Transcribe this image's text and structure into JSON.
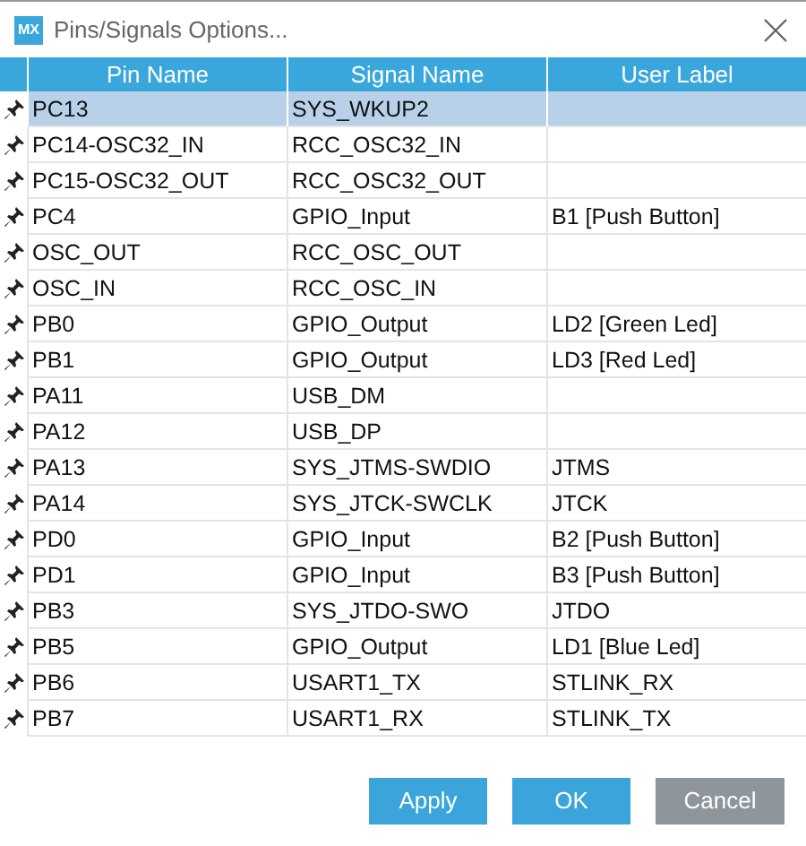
{
  "window": {
    "title": "Pins/Signals Options..."
  },
  "table": {
    "columns": [
      "Pin Name",
      "Signal Name",
      "User Label"
    ],
    "rows": [
      {
        "pin": "PC13",
        "signal": "SYS_WKUP2",
        "label": "",
        "selected": true
      },
      {
        "pin": "PC14-OSC32_IN",
        "signal": "RCC_OSC32_IN",
        "label": "",
        "selected": false
      },
      {
        "pin": "PC15-OSC32_OUT",
        "signal": "RCC_OSC32_OUT",
        "label": "",
        "selected": false
      },
      {
        "pin": "PC4",
        "signal": "GPIO_Input",
        "label": "B1 [Push Button]",
        "selected": false
      },
      {
        "pin": "OSC_OUT",
        "signal": "RCC_OSC_OUT",
        "label": "",
        "selected": false
      },
      {
        "pin": "OSC_IN",
        "signal": "RCC_OSC_IN",
        "label": "",
        "selected": false
      },
      {
        "pin": "PB0",
        "signal": "GPIO_Output",
        "label": "LD2 [Green Led]",
        "selected": false
      },
      {
        "pin": "PB1",
        "signal": "GPIO_Output",
        "label": "LD3 [Red Led]",
        "selected": false
      },
      {
        "pin": "PA11",
        "signal": "USB_DM",
        "label": "",
        "selected": false
      },
      {
        "pin": "PA12",
        "signal": "USB_DP",
        "label": "",
        "selected": false
      },
      {
        "pin": "PA13",
        "signal": "SYS_JTMS-SWDIO",
        "label": "JTMS",
        "selected": false
      },
      {
        "pin": "PA14",
        "signal": "SYS_JTCK-SWCLK",
        "label": "JTCK",
        "selected": false
      },
      {
        "pin": "PD0",
        "signal": "GPIO_Input",
        "label": "B2 [Push Button]",
        "selected": false
      },
      {
        "pin": "PD1",
        "signal": "GPIO_Input",
        "label": "B3 [Push Button]",
        "selected": false
      },
      {
        "pin": "PB3",
        "signal": "SYS_JTDO-SWO",
        "label": "JTDO",
        "selected": false
      },
      {
        "pin": "PB5",
        "signal": "GPIO_Output",
        "label": "LD1 [Blue Led]",
        "selected": false
      },
      {
        "pin": "PB6",
        "signal": "USART1_TX",
        "label": "STLINK_RX",
        "selected": false
      },
      {
        "pin": "PB7",
        "signal": "USART1_RX",
        "label": "STLINK_TX",
        "selected": false
      }
    ]
  },
  "buttons": [
    {
      "label": "Apply",
      "kind": "primary"
    },
    {
      "label": "OK",
      "kind": "primary"
    },
    {
      "label": "Cancel",
      "kind": "secondary"
    }
  ],
  "logo": "MX"
}
